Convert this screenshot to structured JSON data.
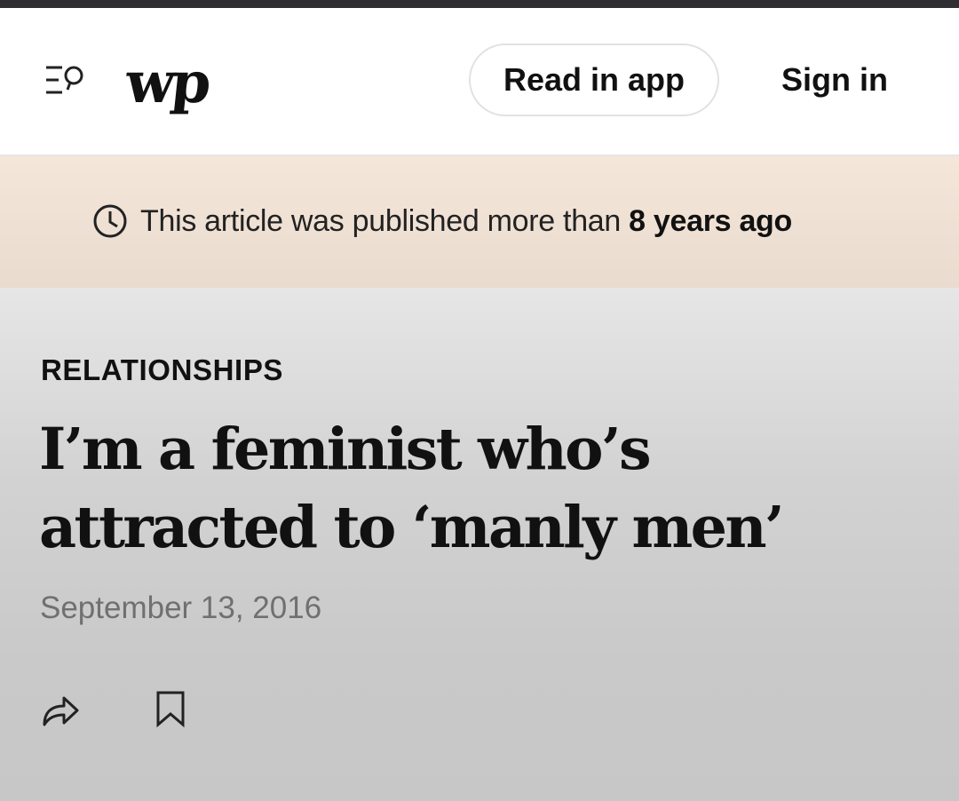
{
  "header": {
    "logo_text": "wp",
    "read_in_app_label": "Read in app",
    "sign_in_label": "Sign in",
    "menu_icon": "menu-search-icon"
  },
  "age_banner": {
    "prefix": "This article was published more than ",
    "emphasis": "8 years ago",
    "icon": "clock-icon"
  },
  "article": {
    "kicker": "RELATIONSHIPS",
    "headline": "I’m a feminist who’s attracted to ‘manly men’",
    "date": "September 13, 2016"
  },
  "actions": {
    "share_icon": "share-icon",
    "bookmark_icon": "bookmark-icon"
  },
  "colors": {
    "top_strip": "#2f2f33",
    "banner": "#f4e6d9",
    "text": "#111111",
    "date_text": "#707070"
  }
}
